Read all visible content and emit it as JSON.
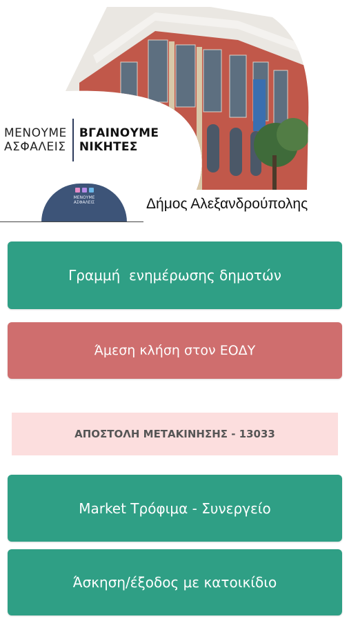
{
  "header": {
    "slogan_left_1": "ΜΕΝΟΥΜΕ",
    "slogan_left_2": "ΑΣΦΑΛΕΙΣ",
    "slogan_right_1": "ΒΓΑΙΝΟΥΜΕ",
    "slogan_right_2": "ΝΙΚΗΤΕΣ",
    "badge_text_1": "ΜΕΝΟΥΜΕ",
    "badge_text_2": "ΑΣΦΑΛΕΙΣ",
    "municipality": "Δήμος Αλεξανδρούπολης"
  },
  "buttons": {
    "info_line": "Γραμμή  ενημέρωσης δημοτών",
    "eody_call": "Άμεση κλήση στον ΕΟΔΥ",
    "sms_movement": "ΑΠΟΣΤΟΛΗ ΜΕΤΑΚΙΝΗΣΗΣ - 13033",
    "market": "Market Τρόφιμα - Συνεργείο",
    "pet": "Άσκηση/έξοδος με κατοικίδιο"
  },
  "colors": {
    "green": "#2f9f85",
    "red": "#cf6e6e",
    "pink": "#fcdede",
    "badge_navy": "#3d5478"
  }
}
